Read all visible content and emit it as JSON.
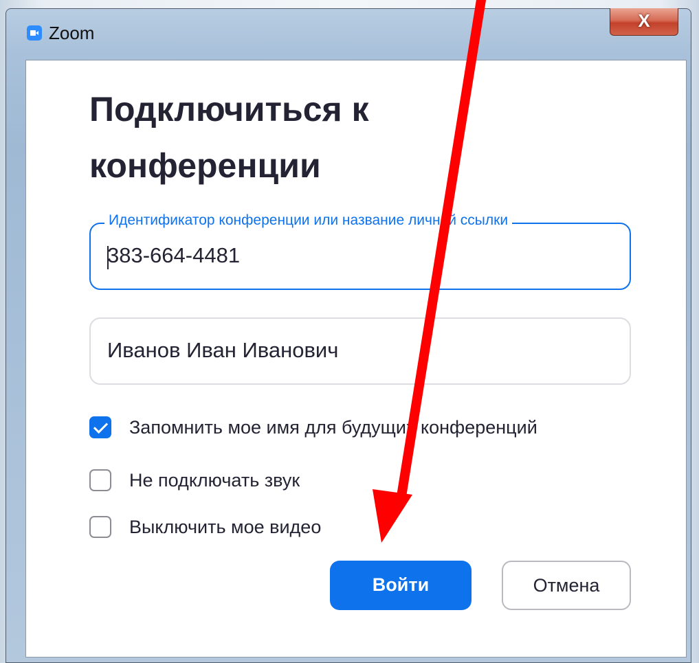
{
  "window": {
    "title": "Zoom",
    "close_label": "X"
  },
  "dialog": {
    "heading": "Подключиться к конференции",
    "meeting_id": {
      "label": "Идентификатор конференции или название личной ссылки",
      "value": "383-664-4481"
    },
    "display_name": {
      "value": "Иванов Иван Иванович"
    },
    "options": [
      {
        "label": "Запомнить мое имя для будущих конференций",
        "checked": true
      },
      {
        "label": "Не подключать звук",
        "checked": false
      },
      {
        "label": "Выключить мое видео",
        "checked": false
      }
    ],
    "buttons": {
      "join": "Войти",
      "cancel": "Отмена"
    }
  },
  "colors": {
    "accent": "#0e72ed",
    "annotation_arrow": "#ff0000",
    "heading_text": "#232333"
  },
  "icons": {
    "app": "zoom-camera-icon",
    "checkbox": "checkmark-icon",
    "annotation": "red-arrow-icon"
  }
}
